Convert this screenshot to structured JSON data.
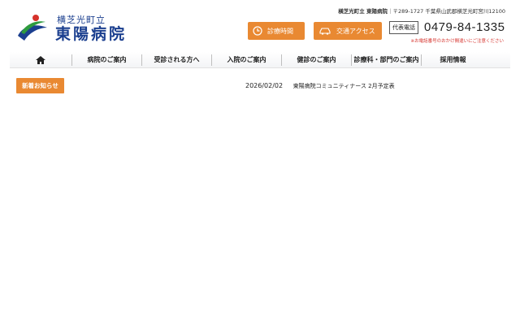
{
  "header": {
    "org": "横芝光町立",
    "hospital_name": "東陽病院",
    "address_prefix": "横芝光町立 東陽病院",
    "address": "｜〒289-1727 千葉県山武郡横芝光町宮川12100",
    "hours_button": "診療時間",
    "access_button": "交通アクセス",
    "phone_tag": "代表電話",
    "phone_number": "0479-84-1335",
    "phone_note": "※お電話番号のおかけ間違いにご注意ください"
  },
  "nav": {
    "items": [
      {
        "label": "",
        "icon": "home-icon"
      },
      {
        "label": "病院のご案内"
      },
      {
        "label": "受診される方へ"
      },
      {
        "label": "入院のご案内"
      },
      {
        "label": "健診のご案内"
      },
      {
        "label": "診療科・部門のご案内"
      },
      {
        "label": "採用情報"
      }
    ]
  },
  "news": {
    "badge": "新着お知らせ",
    "items": [
      {
        "date": "2026/02/02",
        "title": "東陽病院コミュニティナース 2月予定表"
      }
    ]
  },
  "colors": {
    "accent": "#e98932",
    "brand_blue": "#1b3f8f",
    "brand_green": "#2e9b3e",
    "brand_red": "#d6322c"
  }
}
